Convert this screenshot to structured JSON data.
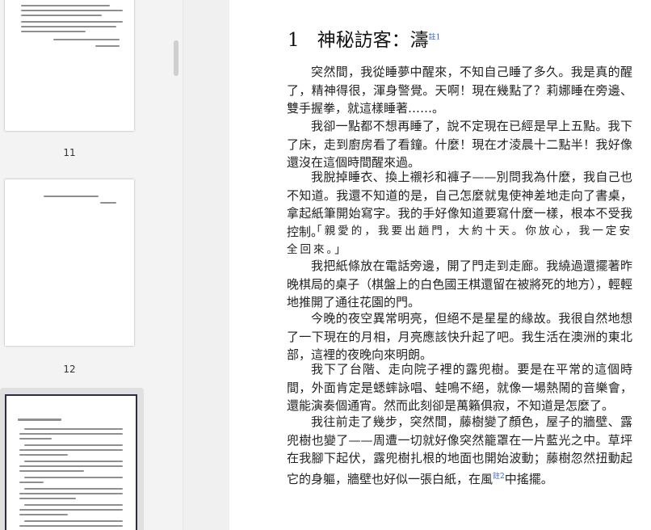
{
  "thumbnails": [
    {
      "label": "11"
    },
    {
      "label": "12"
    }
  ],
  "chapter": {
    "number": "1",
    "title": "神秘訪客：濤",
    "note": "註1"
  },
  "paragraphs": [
    "突然間，我從睡夢中醒來，不知自己睡了多久。我是真的醒了，精神得很，渾身警覺。天啊！現在幾點了？莉娜睡在旁邊、雙手握拳，就這樣睡著……。",
    "我卻一點都不想再睡了，說不定現在已經是早上五點。我下了床，走到廚房看了看鐘。什麼！現在才淩晨十二點半！我好像還沒在這個時間醒來過。",
    "我脫掉睡衣、換上襯衫和褲子——別問我為什麼，我自己也不知道。我還不知道的是，自己怎麼就鬼使神差地走向了書桌，拿起紙筆開始寫字。我的手好像知道要寫什麼一樣，根本不受我控制。",
    "「親愛的，我要出趟門，大約十天。你放心，我一定安全回來。」",
    "我把紙條放在電話旁邊，開了門走到走廊。我繞過還擺著昨晚棋局的桌子（棋盤上的白色國王棋還留在被將死的地方），輕輕地推開了通往花園的門。",
    "今晚的夜空異常明亮，但絕不是星星的緣故。我很自然地想了一下現在的月相，月亮應該快升起了吧。我生活在澳洲的東北部，這裡的夜晚向來明朗。",
    "我下了台階、走向院子裡的露兜樹。要是在平常的這個時間，外面肯定是蟋蟀詠唱、蛙鳴不絕，就像一場熱鬧的音樂會，還能演奏個通宵。然而此刻卻是萬籟俱寂，不知道是怎麼了。"
  ],
  "last_paragraph": {
    "before": "我往前走了幾步，突然間，藤樹變了顏色，屋子的牆壁、露兜樹也變了——周遭一切就好像突然籠罩在一片藍光之中。草坪在我腳下起伏，露兜樹扎根的地面也開始波動；藤樹忽然扭動起它的身軀，牆壁也好似一張白紙，在風",
    "note": "註2",
    "after": "中搖擺。"
  }
}
